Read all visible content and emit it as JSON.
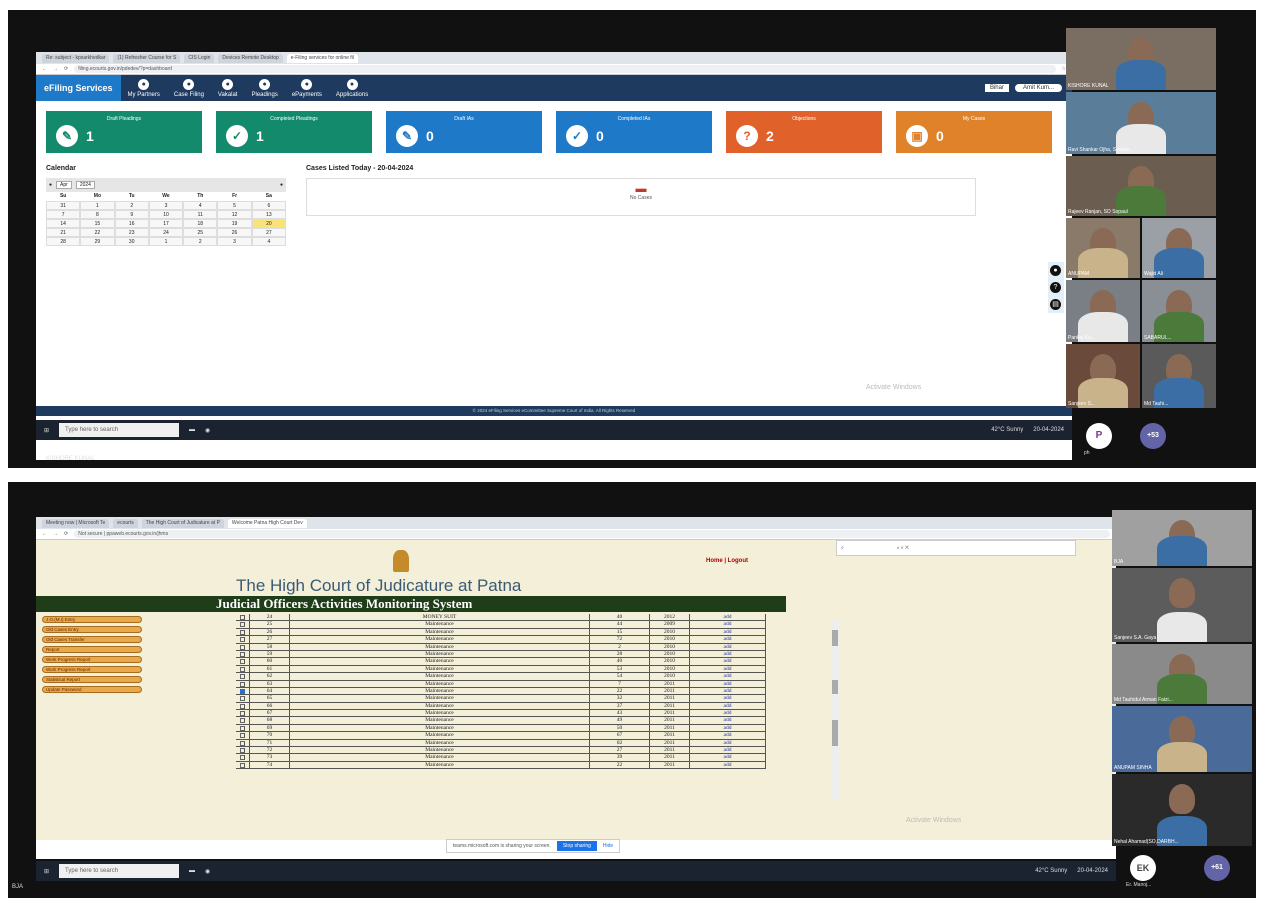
{
  "panel1": {
    "browser": {
      "tabs": [
        "Re: subject - kpsarkhedkar",
        "(1) Refresher Course for S",
        "CIS Login",
        "Devices Remote Desktop",
        "e-Filing services for online fil"
      ],
      "url": "filing.ecourts.gov.in/pdedev/?p=dashboard"
    },
    "navbar": {
      "brand": "eFiling Services",
      "items": [
        "My Partners",
        "Case Filing",
        "Vakalat",
        "Pleadings",
        "ePayments",
        "Applications"
      ],
      "lang": "Bihar",
      "user": "Amit Kum..."
    },
    "cards": [
      {
        "title": "Draft Pleadings",
        "value": "1",
        "icon": "✎",
        "color": "#138a6b"
      },
      {
        "title": "Completed Pleadings",
        "value": "1",
        "icon": "✓",
        "color": "#138a6b"
      },
      {
        "title": "Draft IAs",
        "value": "0",
        "icon": "✎",
        "color": "#1e7ac8"
      },
      {
        "title": "Completed IAs",
        "value": "0",
        "icon": "✓",
        "color": "#1e7ac8"
      },
      {
        "title": "Objections",
        "value": "2",
        "icon": "?",
        "color": "#e0622a"
      },
      {
        "title": "My Cases",
        "value": "0",
        "icon": "▣",
        "color": "#e0822a"
      }
    ],
    "calendar": {
      "heading": "Calendar",
      "month": "Apr",
      "year": "2024",
      "weekdays": [
        "Su",
        "Mo",
        "Tu",
        "We",
        "Th",
        "Fr",
        "Sa"
      ],
      "days": [
        "31",
        "1",
        "2",
        "3",
        "4",
        "5",
        "6",
        "7",
        "8",
        "9",
        "10",
        "11",
        "12",
        "13",
        "14",
        "15",
        "16",
        "17",
        "18",
        "19",
        "20",
        "21",
        "22",
        "23",
        "24",
        "25",
        "26",
        "27",
        "28",
        "29",
        "30",
        "1",
        "2",
        "3",
        "4"
      ],
      "highlight_day": "20"
    },
    "today": {
      "heading": "Cases Listed Today - 20-04-2024",
      "empty": "No Cases"
    },
    "footer": "© 2024 eFiling Services eCommittee Supreme Court of India. All Rights Reserved",
    "watermark": "Activate Windows",
    "taskbar": {
      "search": "Type here to search",
      "weather": "42°C Sunny",
      "time": "20-04-2024"
    },
    "sharer": "KISHORE KUNAL",
    "participants": [
      "KISHORE KUNAL",
      "Ravi Shankar Ojha, System...",
      "Rajeev Ranjan, SO Sopaul",
      "ANUPAM",
      "Wajid Ali",
      "Pankaj Ku...",
      "SABARUL...",
      "Sanjeev S...",
      "Md Tauhi..."
    ],
    "avatar": "P",
    "more": "+53",
    "avatar_sub": "ph"
  },
  "panel2": {
    "browser": {
      "tabs": [
        "Meeting now | Microsoft Te",
        "ecourts",
        "The High Court of Judicature at P",
        "Welcome Patna High Court Dev"
      ],
      "url": "Not secure | ppaweb.ecourts.gov.in/jhms"
    },
    "header": {
      "title": "The High Court of Judicature at Patna",
      "links": "Home | Logout",
      "system": "Judicial Officers Activities Monitoring System"
    },
    "menu": [
      "J.O.(M.I) Entry",
      "Old Cases Entry",
      "Old Cases Transfer",
      "Report",
      "Work Progress Report",
      "Work Progress Report",
      "Statistical Report",
      "Update Password"
    ],
    "rows": [
      {
        "checked": false,
        "sn": "24",
        "type": "MONEY SUIT",
        "no": "40",
        "year": "2012",
        "act": "add"
      },
      {
        "checked": false,
        "sn": "25",
        "type": "Maintenance",
        "no": "44",
        "year": "2009",
        "act": "add"
      },
      {
        "checked": false,
        "sn": "26",
        "type": "Maintenance",
        "no": "15",
        "year": "2010",
        "act": "add"
      },
      {
        "checked": false,
        "sn": "27",
        "type": "Maintenance",
        "no": "72",
        "year": "2010",
        "act": "add"
      },
      {
        "checked": false,
        "sn": "58",
        "type": "Maintenance",
        "no": "2",
        "year": "2010",
        "act": "add"
      },
      {
        "checked": false,
        "sn": "59",
        "type": "Maintenance",
        "no": "28",
        "year": "2010",
        "act": "add"
      },
      {
        "checked": false,
        "sn": "60",
        "type": "Maintenance",
        "no": "40",
        "year": "2010",
        "act": "add"
      },
      {
        "checked": false,
        "sn": "61",
        "type": "Maintenance",
        "no": "53",
        "year": "2010",
        "act": "add"
      },
      {
        "checked": false,
        "sn": "62",
        "type": "Maintenance",
        "no": "54",
        "year": "2010",
        "act": "add"
      },
      {
        "checked": false,
        "sn": "63",
        "type": "Maintenance",
        "no": "7",
        "year": "2011",
        "act": "add"
      },
      {
        "checked": true,
        "sn": "64",
        "type": "Maintenance",
        "no": "22",
        "year": "2011",
        "act": "add"
      },
      {
        "checked": false,
        "sn": "65",
        "type": "Maintenance",
        "no": "32",
        "year": "2011",
        "act": "add"
      },
      {
        "checked": false,
        "sn": "66",
        "type": "Maintenance",
        "no": "37",
        "year": "2011",
        "act": "add"
      },
      {
        "checked": false,
        "sn": "67",
        "type": "Maintenance",
        "no": "43",
        "year": "2011",
        "act": "add"
      },
      {
        "checked": false,
        "sn": "68",
        "type": "Maintenance",
        "no": "49",
        "year": "2011",
        "act": "add"
      },
      {
        "checked": false,
        "sn": "69",
        "type": "Maintenance",
        "no": "50",
        "year": "2011",
        "act": "add"
      },
      {
        "checked": false,
        "sn": "70",
        "type": "Maintenance",
        "no": "67",
        "year": "2011",
        "act": "add"
      },
      {
        "checked": false,
        "sn": "71",
        "type": "Maintenance",
        "no": "02",
        "year": "2011",
        "act": "add"
      },
      {
        "checked": false,
        "sn": "72",
        "type": "Maintenance",
        "no": "27",
        "year": "2011",
        "act": "add"
      },
      {
        "checked": false,
        "sn": "73",
        "type": "Maintenance",
        "no": "39",
        "year": "2011",
        "act": "add"
      },
      {
        "checked": false,
        "sn": "74",
        "type": "Maintenance",
        "no": "22",
        "year": "2011",
        "act": "add"
      }
    ],
    "sharebar": {
      "text": "teams.microsoft.com is sharing your screen.",
      "stop": "Stop sharing",
      "hide": "Hide"
    },
    "watermark": "Activate Windows",
    "taskbar": {
      "search": "Type here to search",
      "weather": "42°C Sunny",
      "time": "20-04-2024"
    },
    "sharer": "BJA",
    "participants": [
      "BJA",
      "Sanjeev S.A. Gaya",
      "Md Tauhidul Arman Faizi...",
      "ANUPAM SINHA",
      "Nehal Ahamad(SO,DARBH..."
    ],
    "avatar": "EK",
    "avatar_sub": "Er. Manoj...",
    "more": "+61"
  }
}
